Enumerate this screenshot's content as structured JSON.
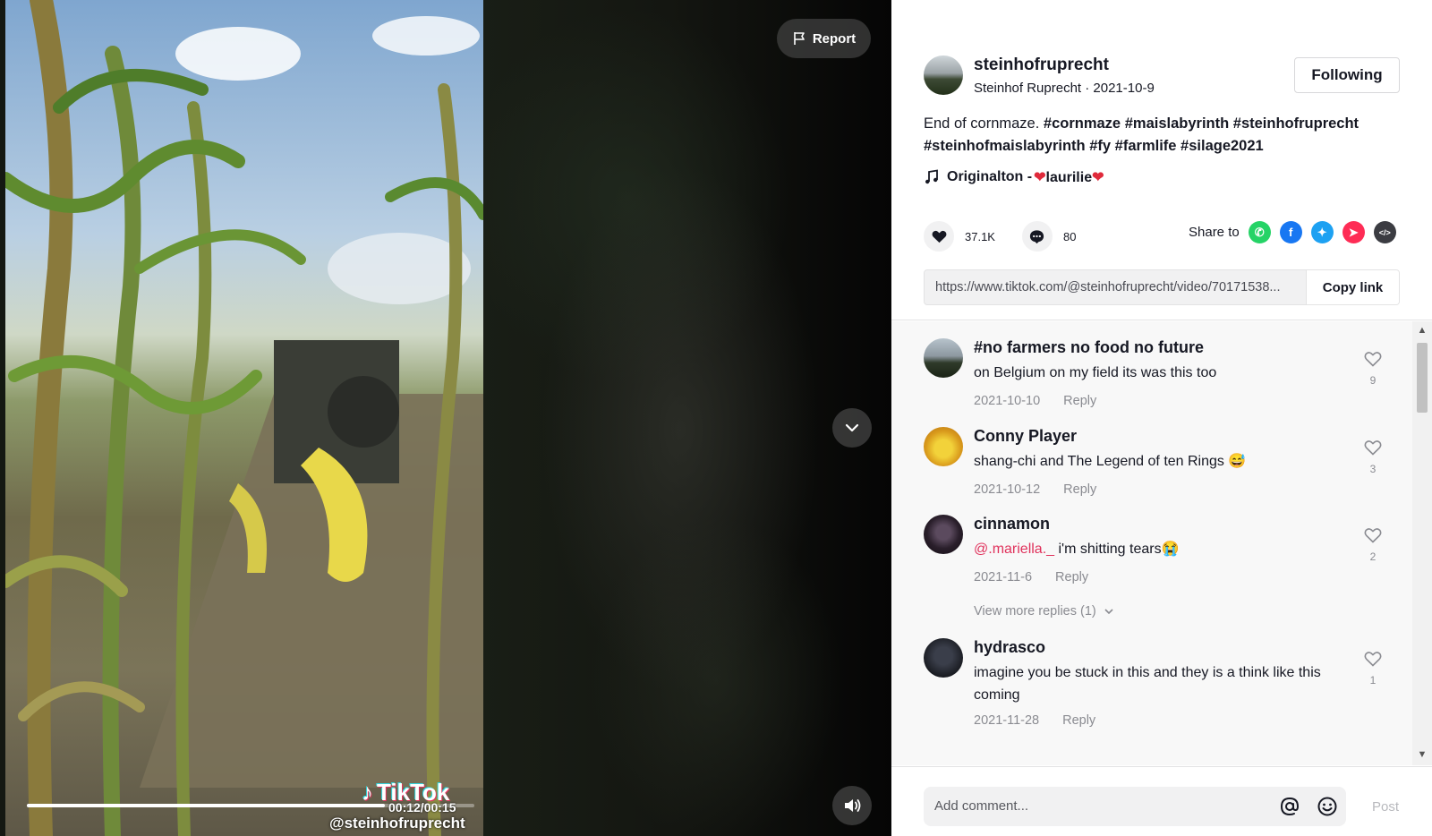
{
  "video": {
    "report_label": "Report",
    "time": "00:12/00:15",
    "progress_fraction": 0.8,
    "watermark_logo": "TikTok",
    "watermark_handle": "@steinhofruprecht"
  },
  "author": {
    "username": "steinhofruprecht",
    "subtitle": "Steinhof Ruprecht · 2021-10-9",
    "follow_label": "Following"
  },
  "description": {
    "text": "End of cornmaze. ",
    "tags": [
      "#cornmaze",
      "#maislabyrinth",
      "#steinhofruprecht",
      "#steinhofmaislabyrinth",
      "#fy",
      "#farmlife",
      "#silage2021"
    ]
  },
  "music": {
    "prefix": "Originalton - ",
    "name": "laurilie"
  },
  "stats": {
    "likes": "37.1K",
    "comments": "80",
    "share_label": "Share to"
  },
  "share_icons": [
    {
      "name": "whatsapp-icon",
      "color": "#25d366",
      "glyph": "✆"
    },
    {
      "name": "facebook-icon",
      "color": "#1877f2",
      "glyph": "f"
    },
    {
      "name": "twitter-icon",
      "color": "#1da1f2",
      "glyph": "✦"
    },
    {
      "name": "send-icon",
      "color": "#fe2c55",
      "glyph": "➤"
    },
    {
      "name": "embed-icon",
      "color": "#3b3c42",
      "glyph": "</>"
    }
  ],
  "link": {
    "url": "https://www.tiktok.com/@steinhofruprecht/video/70171538...",
    "copy_label": "Copy link"
  },
  "comments": [
    {
      "user": "#no farmers no food no future",
      "text": "on Belgium on my field its was this too",
      "date": "2021-10-10",
      "reply": "Reply",
      "likes": "9"
    },
    {
      "user": "Conny Player",
      "text": "shang-chi and The Legend of ten Rings 😅",
      "date": "2021-10-12",
      "reply": "Reply",
      "likes": "3"
    },
    {
      "user": "cinnamon",
      "mention": "@.mariella._",
      "text": " i'm shitting tears😭",
      "date": "2021-11-6",
      "reply": "Reply",
      "likes": "2",
      "more_replies": "View more replies (1)"
    },
    {
      "user": "hydrasco",
      "text": "imagine you be stuck in this and they is a think like this coming",
      "date": "2021-11-28",
      "reply": "Reply",
      "likes": "1"
    }
  ],
  "comment_box": {
    "placeholder": "Add comment...",
    "post_label": "Post"
  }
}
